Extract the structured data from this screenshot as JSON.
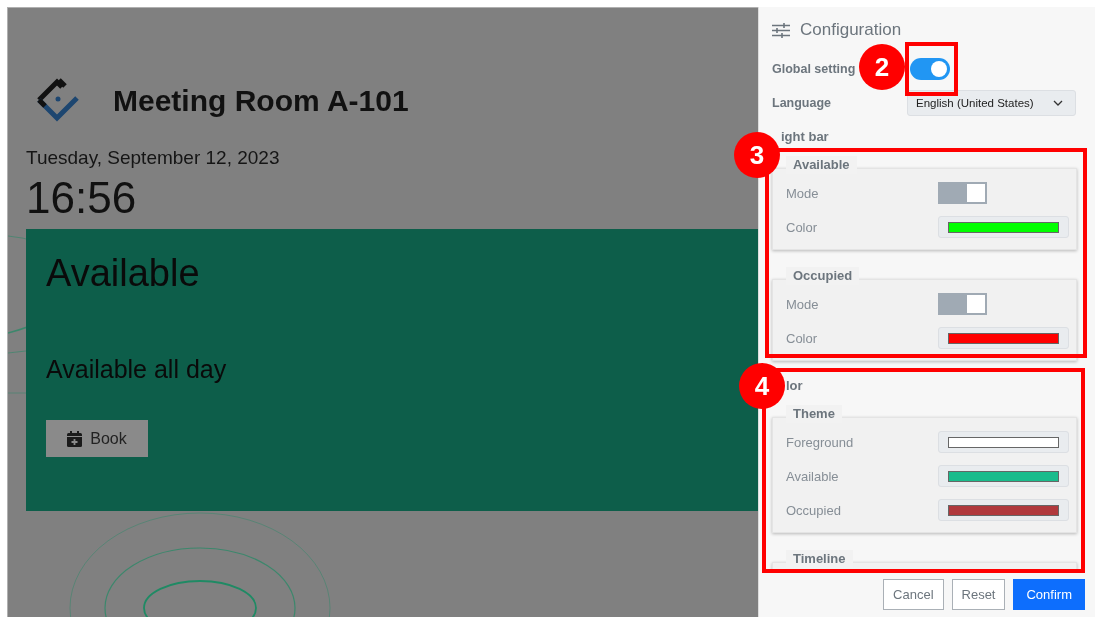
{
  "main": {
    "room_title": "Meeting Room A-101",
    "date": "Tuesday, September 12, 2023",
    "time": "16:56",
    "status_card": {
      "status": "Available",
      "detail": "Available all day",
      "book_button": "Book"
    }
  },
  "config_panel": {
    "title": "Configuration",
    "global_setting": {
      "label": "Global setting",
      "on": true
    },
    "language": {
      "label": "Language",
      "value": "English (United States)"
    },
    "light_bar": {
      "label": "ight bar",
      "groups": [
        {
          "legend": "Available",
          "mode": {
            "label": "Mode",
            "on": true,
            "disabled": true
          },
          "color": {
            "label": "Color",
            "color": "#00ff00"
          }
        },
        {
          "legend": "Occupied",
          "mode": {
            "label": "Mode",
            "on": true,
            "disabled": true
          },
          "color": {
            "label": "Color",
            "color": "#ff0000"
          }
        }
      ]
    },
    "color_section": {
      "label": "lor",
      "theme": {
        "legend": "Theme",
        "items": [
          {
            "label": "Foreground",
            "color": "#ffffff"
          },
          {
            "label": "Available",
            "color": "#1abc8c"
          },
          {
            "label": "Occupied",
            "color": "#b0393d"
          }
        ]
      },
      "timeline": {
        "legend": "Timeline"
      }
    },
    "buttons": [
      {
        "label": "Cancel",
        "kind": "secondary"
      },
      {
        "label": "Reset",
        "kind": "secondary"
      },
      {
        "label": "Confirm",
        "kind": "primary"
      }
    ]
  },
  "annotations": [
    {
      "number": "2"
    },
    {
      "number": "3"
    },
    {
      "number": "4"
    }
  ]
}
